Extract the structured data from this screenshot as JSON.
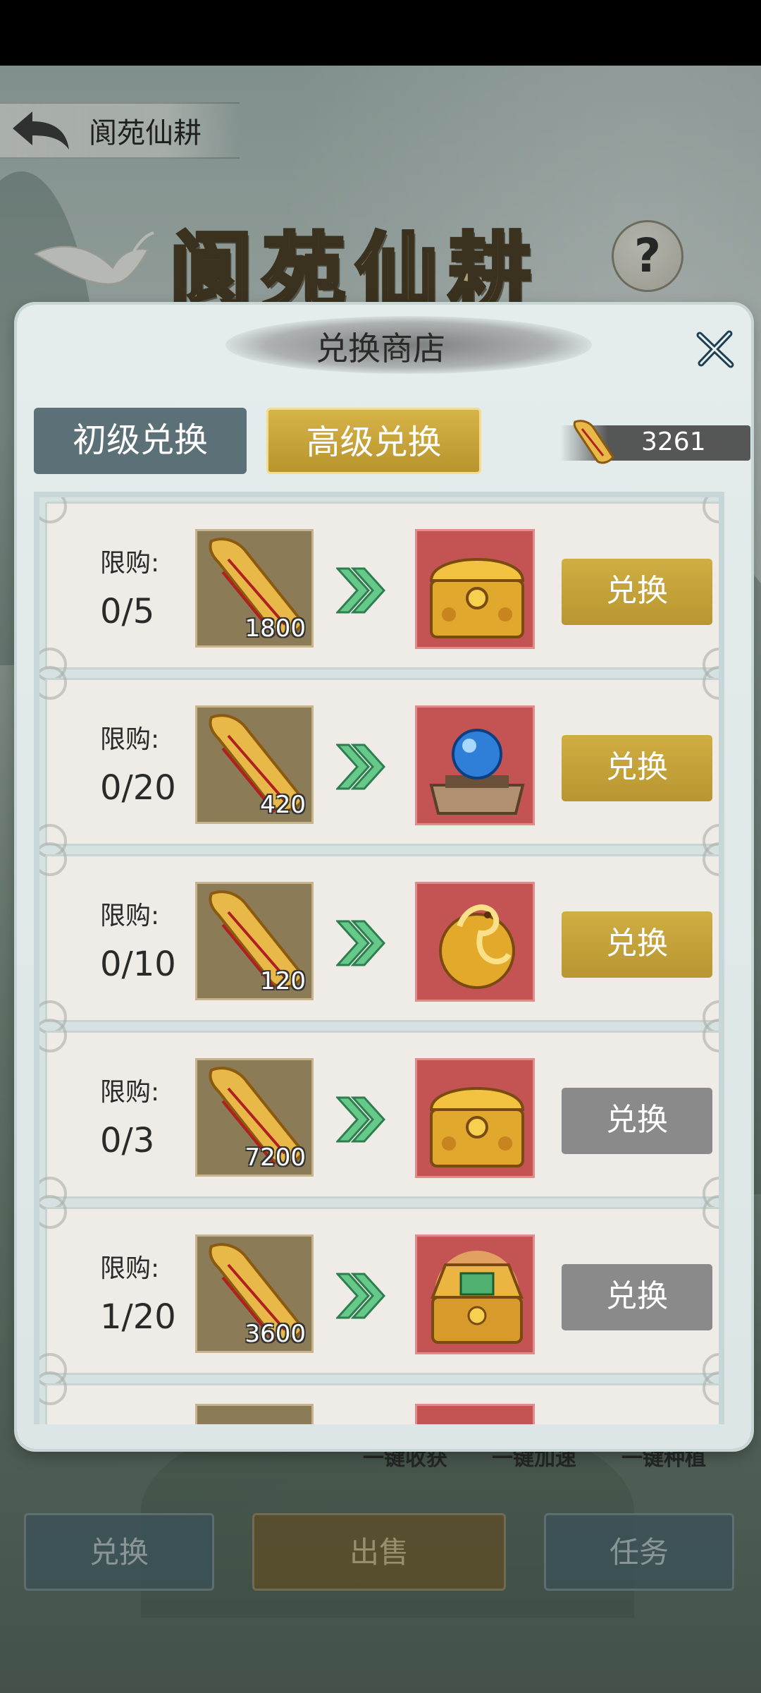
{
  "topbar": {
    "title": "阆苑仙耕"
  },
  "banner": {
    "title": "阆苑仙耕",
    "help": "?"
  },
  "background_labels": [
    "一键收获",
    "一键加速",
    "一键种植"
  ],
  "bottom_buttons": [
    "兑换",
    "出售",
    "任务"
  ],
  "modal": {
    "title": "兑换商店",
    "tabs": [
      {
        "label": "初级兑换",
        "active": false
      },
      {
        "label": "高级兑换",
        "active": true
      }
    ],
    "currency": {
      "icon": "scroll-icon",
      "value": "3261"
    },
    "items": [
      {
        "limit_label": "限购:",
        "limit": "0/5",
        "cost": "1800",
        "reward_icon": "golden-chest-icon",
        "button": "兑换",
        "enabled": true
      },
      {
        "limit_label": "限购:",
        "limit": "0/20",
        "cost": "420",
        "reward_icon": "blue-orb-icon",
        "button": "兑换",
        "enabled": true
      },
      {
        "limit_label": "限购:",
        "limit": "0/10",
        "cost": "120",
        "reward_icon": "golden-pet-icon",
        "button": "兑换",
        "enabled": true
      },
      {
        "limit_label": "限购:",
        "limit": "0/3",
        "cost": "7200",
        "reward_icon": "golden-chest-icon",
        "button": "兑换",
        "enabled": false
      },
      {
        "limit_label": "限购:",
        "limit": "1/20",
        "cost": "3600",
        "reward_icon": "treasure-chest-open-icon",
        "button": "兑换",
        "enabled": false
      }
    ]
  },
  "colors": {
    "gold": "#cfae43",
    "teal": "#5c7177",
    "reward_bg": "#c45454",
    "disabled": "#8a8a8a"
  }
}
